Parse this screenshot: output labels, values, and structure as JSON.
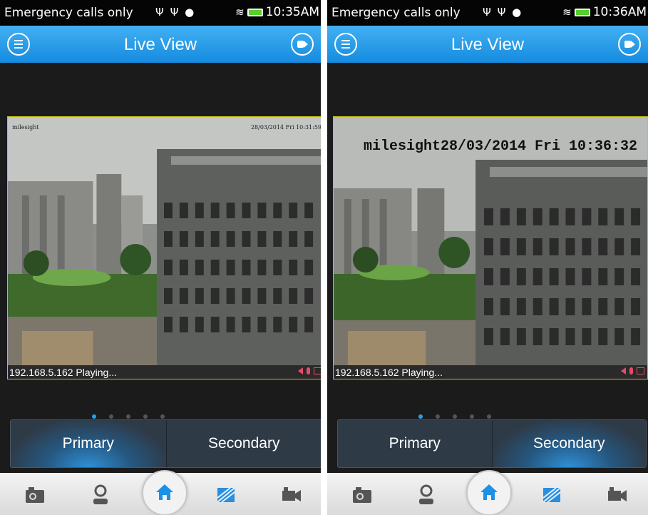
{
  "screens": [
    {
      "status_bar": {
        "carrier": "Emergency calls only",
        "time": "10:35AM"
      },
      "title": "Live View",
      "video": {
        "osd_left": "milesight",
        "osd_right": "28/03/2014 Fri 10:31:59",
        "status_text": "192.168.5.162 Playing..."
      },
      "page_indicator": {
        "count": 5,
        "active": 1
      },
      "stream_buttons": {
        "primary": "Primary",
        "secondary": "Secondary",
        "selected": "Primary"
      },
      "bottom_tabs": [
        "camera-snapshot-icon",
        "playback-person-icon",
        "home-icon",
        "image-grid-icon",
        "video-record-icon"
      ]
    },
    {
      "status_bar": {
        "carrier": "Emergency calls only",
        "time": "10:36AM"
      },
      "title": "Live View",
      "video": {
        "osd_text": "milesight28/03/2014 Fri 10:36:32",
        "status_text": "192.168.5.162 Playing..."
      },
      "page_indicator": {
        "count": 5,
        "active": 1
      },
      "stream_buttons": {
        "primary": "Primary",
        "secondary": "Secondary",
        "selected": "Secondary"
      },
      "bottom_tabs": [
        "camera-snapshot-icon",
        "playback-person-icon",
        "home-icon",
        "image-grid-icon",
        "video-record-icon"
      ]
    }
  ],
  "colors": {
    "accent": "#1e9bf0",
    "overlay_border": "#c7c21d",
    "status_icons": "#e84b6a"
  }
}
